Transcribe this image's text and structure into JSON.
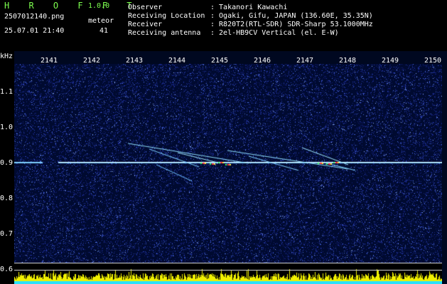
{
  "header": {
    "app_name": "H R O F F T",
    "version": "1.0.0",
    "filename": "2507012140.png",
    "datetime": "25.07.01 21:40",
    "meteor_label": "meteor",
    "meteor_count": "41",
    "fields": [
      {
        "label": "Observer",
        "value": ": Takanori Kawachi"
      },
      {
        "label": "Receiving Location",
        "value": ": Ogaki, Gifu, JAPAN (136.60E, 35.35N)"
      },
      {
        "label": "Receiver",
        "value": ": R820T2(RTL-SDR) SDR-Sharp 53.1000MHz"
      },
      {
        "label": "Receiving antenna",
        "value": ": 2el-HB9CV Vertical (el. E-W)"
      }
    ]
  },
  "axes": {
    "y_unit": "kHz",
    "x_ticks": [
      "2141",
      "2142",
      "2143",
      "2144",
      "2145",
      "2146",
      "2147",
      "2148",
      "2149",
      "2150"
    ],
    "y_ticks": [
      "1.1",
      "1.0",
      "0.9",
      "0.8",
      "0.7",
      "0.6"
    ]
  },
  "colors": {
    "background": "#000000",
    "noise": "#1a2a8a",
    "signal": "#9fdcff",
    "meteor_hot": "#ff3030",
    "bottom_level": "#ffff00",
    "bottom_base": "#2ae0ff"
  }
}
